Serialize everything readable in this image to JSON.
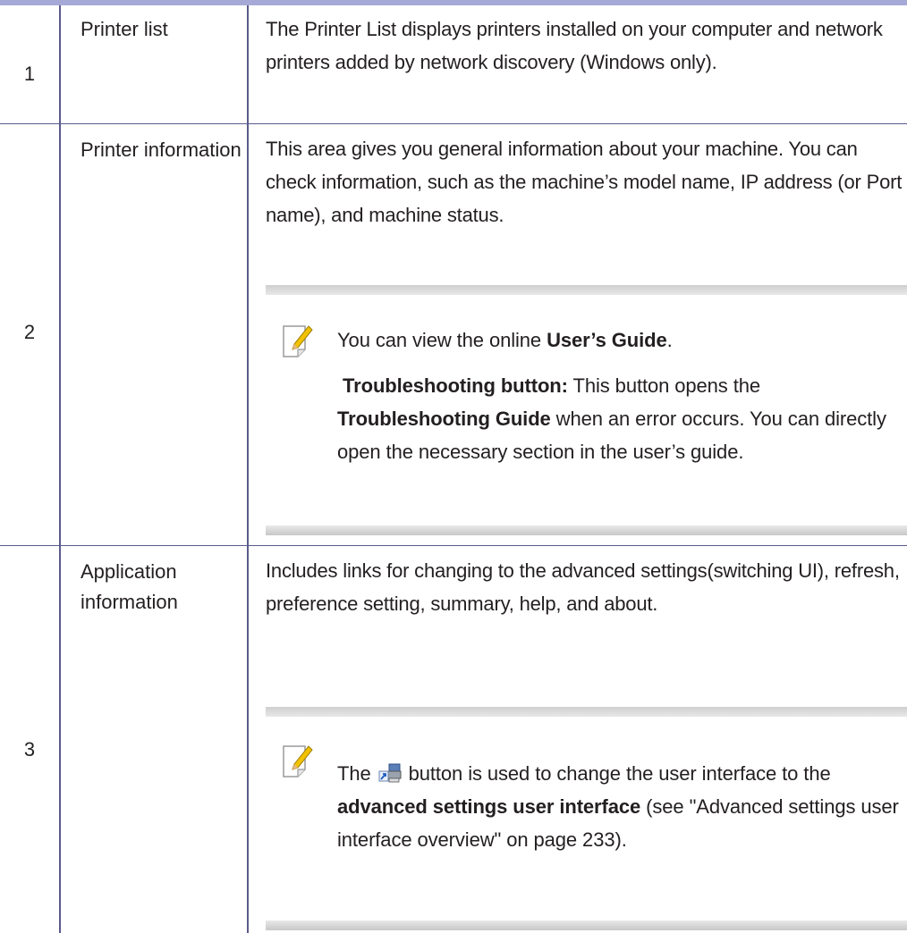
{
  "rows": [
    {
      "number": "1",
      "name": "Printer list",
      "description": "The Printer List displays printers installed on your computer and network printers added by network discovery (Windows only)."
    },
    {
      "number": "2",
      "name": "Printer information",
      "description": "This area gives you general information about your machine. You can check information, such as the machine’s model name, IP address (or Port name), and machine status.",
      "note": {
        "icon": "note-pencil-icon",
        "line1_prefix": "You can view the online ",
        "line1_bold": "User’s Guide",
        "line1_suffix": ".",
        "line2_bold_label": "Troubleshooting button:",
        "line2_text_a": " This button opens the ",
        "line2_bold_guide": "Troubleshooting Guide",
        "line2_text_b": " when an error occurs. You can directly open the necessary section in the user’s guide."
      }
    },
    {
      "number": "3",
      "name": "Application information",
      "description": "Includes links for changing to the advanced settings(switching UI), refresh, preference setting, summary, help, and about.",
      "note": {
        "icon": "note-pencil-icon",
        "prefix": "The",
        "button_icon": "switch-ui-icon",
        "text_a": "button is used to change the user interface to the ",
        "bold": "advanced settings user interface",
        "text_b": " (see \"Advanced settings user interface overview\" on page 233)."
      }
    }
  ],
  "colors": {
    "rule": "#5a5a8c",
    "header_band": "#a6a9d6",
    "note_bar": "#d0d0d0",
    "text": "#231f20"
  }
}
